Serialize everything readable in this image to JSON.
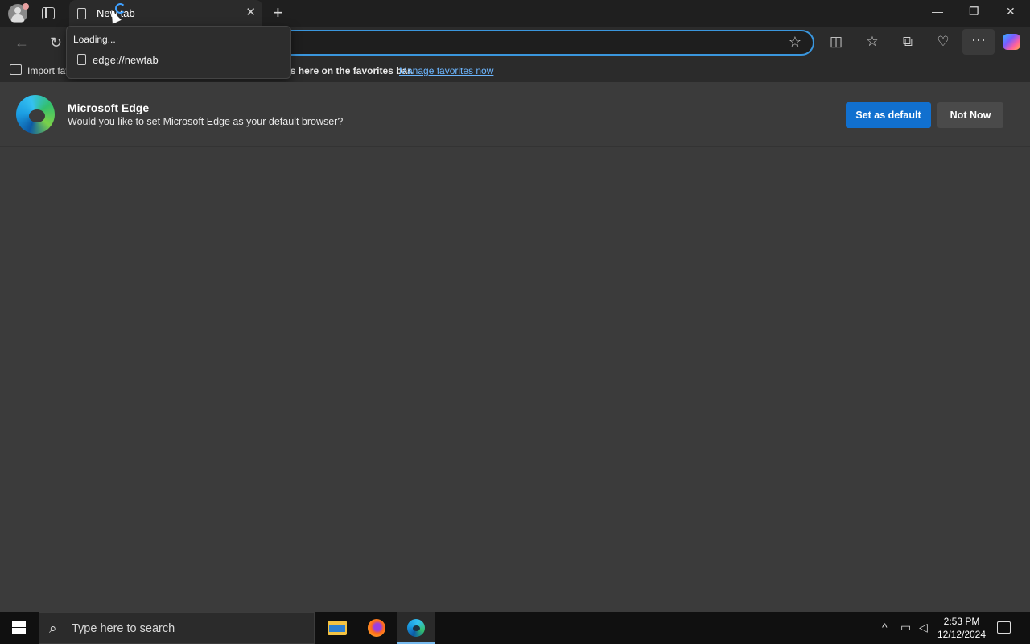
{
  "tab": {
    "title": "New tab",
    "close": "✕"
  },
  "titlebar": {
    "new_tab": "+",
    "minimize": "—",
    "restore": "❐",
    "close": "✕"
  },
  "toolbar": {
    "back": "←",
    "refresh": "↻",
    "address_value": "",
    "favorite_star": "☆",
    "more": "···"
  },
  "toolbar_icons": [
    "split-screen-icon",
    "favorites-icon",
    "collections-icon",
    "browser-essentials-icon"
  ],
  "popup": {
    "status": "Loading...",
    "url": "edge://newtab"
  },
  "favorites_bar": {
    "import_label": "Import favorites",
    "message": "For quick access, place your favorites here on the favorites bar.",
    "manage_link": "Manage favorites now"
  },
  "banner": {
    "title": "Microsoft Edge",
    "subtitle": "Would you like to set Microsoft Edge as your default browser?",
    "set_default": "Set as default",
    "not_now": "Not Now"
  },
  "taskbar": {
    "search_placeholder": "Type here to search",
    "time": "2:53 PM",
    "date": "12/12/2024"
  },
  "colors": {
    "accent": "#1170cf",
    "link": "#6cb6ff",
    "page_bg": "#3b3b3b",
    "chrome_bg": "#2b2b2b"
  }
}
